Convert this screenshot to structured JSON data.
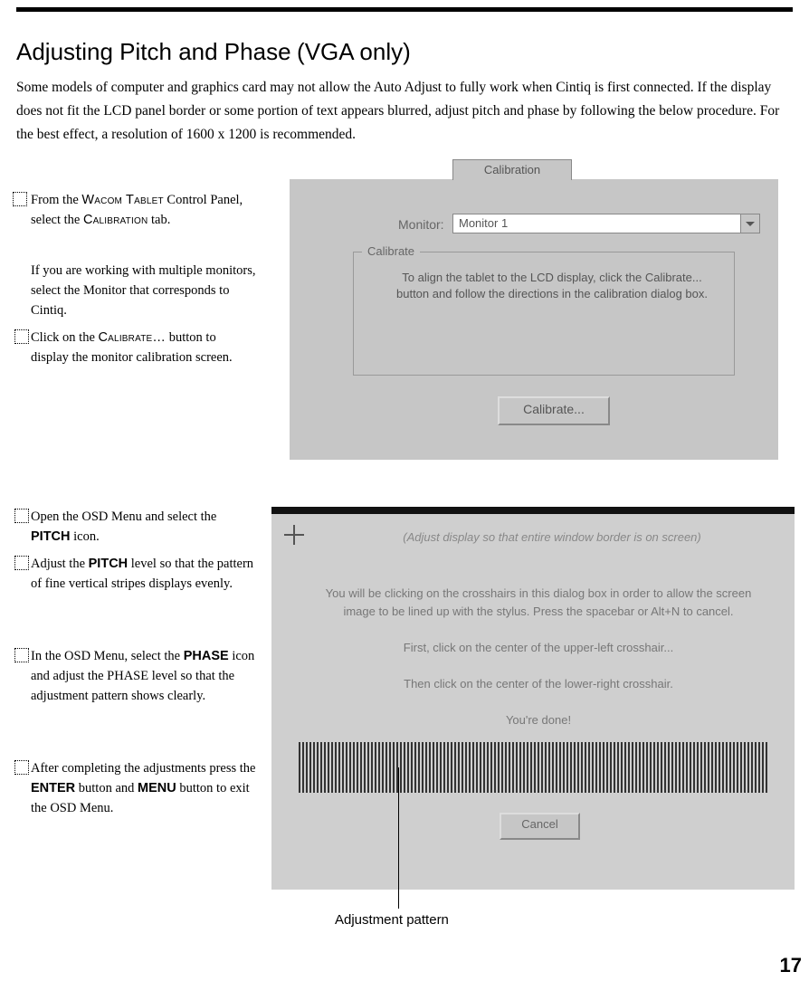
{
  "page_number": "17",
  "title": "Adjusting Pitch and Phase",
  "title_suffix": "(VGA only)",
  "intro": "Some models of computer and graphics card may not allow the Auto Adjust to fully work when Cintiq is first connected. If the display does not fit the LCD panel border or some portion of text appears blurred, adjust pitch and phase by following the below procedure.  For the best effect, a resolution of 1600 x 1200 is recommended.",
  "steps": {
    "s1a": "From the ",
    "s1_wacom": "Wacom Tablet",
    "s1b": " Control Panel, select the ",
    "s1_calib_tab": "Calibration",
    "s1c": " tab.",
    "s1_multi": "If you are working with multiple monitors, select the Monitor that corresponds to Cintiq.",
    "s2a": "Click on the ",
    "s2_calibrate": "Calibrate…",
    "s2b": " button to display the monitor calibration screen.",
    "s3a": "Open the OSD Menu and select the ",
    "s3_pitch": "PITCH",
    "s3b": " icon.",
    "s4a": "Adjust the ",
    "s4_pitch": "PITCH",
    "s4b": " level so that the pattern of fine vertical stripes displays evenly.",
    "s5a": "In the OSD Menu, select the ",
    "s5_phase": "PHASE",
    "s5b": " icon and adjust the PHASE level so that the adjustment pattern shows clearly.",
    "s6a": "After completing the adjustments press the  ",
    "s6_enter": "ENTER",
    "s6b": " button and ",
    "s6_menu": "MENU",
    "s6c": "  button to exit the OSD Menu."
  },
  "dialog1": {
    "tab_label": "Calibration",
    "monitor_label": "Monitor:",
    "monitor_value": "Monitor 1",
    "group_label": "Calibrate",
    "group_text": "To align the tablet to the LCD display, click the Calibrate... button and follow the directions in the calibration dialog box.",
    "button_label": "Calibrate..."
  },
  "dialog2": {
    "hint": "(Adjust display so that entire window border is on screen)",
    "line1": "You will be clicking on the crosshairs in this dialog box in order to allow the screen image to be lined up with the stylus. Press the spacebar or Alt+N to cancel.",
    "line2": "First, click on the center of the upper-left crosshair...",
    "line3": "Then click on the center of the lower-right crosshair.",
    "line4": "You're done!",
    "button_label": "Cancel"
  },
  "callout_label": "Adjustment pattern"
}
